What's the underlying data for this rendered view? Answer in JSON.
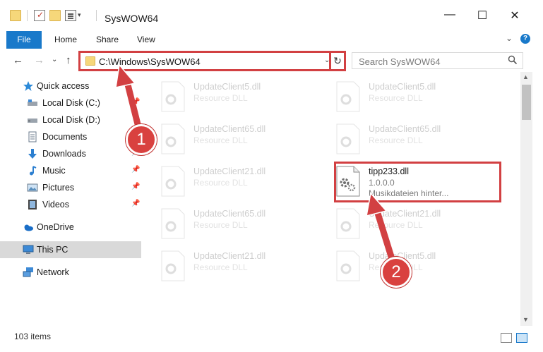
{
  "window": {
    "title": "SysWOW64",
    "minimize": "—",
    "maximize": "☐",
    "close": "✕"
  },
  "ribbon": {
    "tabs": [
      "File",
      "Home",
      "Share",
      "View"
    ],
    "collapse": "⌄",
    "help": "?"
  },
  "nav": {
    "back": "←",
    "forward": "→",
    "recent": "⌄",
    "up": "↑",
    "address": "C:\\Windows\\SysWOW64",
    "address_dropdown": "⌄",
    "refresh": "↻",
    "search_placeholder": "Search SysWOW64"
  },
  "sidebar": {
    "items": [
      {
        "label": "Quick access",
        "icon": "star-icon"
      },
      {
        "label": "Local Disk (C:)",
        "icon": "drive-icon"
      },
      {
        "label": "Local Disk (D:)",
        "icon": "drive-icon"
      },
      {
        "label": "Documents",
        "icon": "documents-icon"
      },
      {
        "label": "Downloads",
        "icon": "download-icon"
      },
      {
        "label": "Music",
        "icon": "music-icon"
      },
      {
        "label": "Pictures",
        "icon": "pictures-icon"
      },
      {
        "label": "Videos",
        "icon": "videos-icon"
      },
      {
        "label": "OneDrive",
        "icon": "cloud-icon"
      },
      {
        "label": "This PC",
        "icon": "pc-icon"
      },
      {
        "label": "Network",
        "icon": "network-icon"
      }
    ],
    "selected": "This PC"
  },
  "files": [
    {
      "name": "UpdateClient5.dll",
      "desc": "Resource DLL"
    },
    {
      "name": "UpdateClient5.dll",
      "desc": "Resource DLL"
    },
    {
      "name": "UpdateClient65.dll",
      "desc": "Resource DLL"
    },
    {
      "name": "UpdateClient65.dll",
      "desc": "Resource DLL"
    },
    {
      "name": "UpdateClient21.dll",
      "desc": "Resource DLL"
    },
    {
      "name": "tipp233.dll",
      "version": "1.0.0.0",
      "desc": "Musikdateien hinter..."
    },
    {
      "name": "UpdateClient65.dll",
      "desc": "Resource DLL"
    },
    {
      "name": "UpdateClient21.dll",
      "desc": "Resource DLL"
    },
    {
      "name": "UpdateClient21.dll",
      "desc": "Resource DLL"
    },
    {
      "name": "UpdateClient5.dll",
      "desc": "Resource DLL"
    }
  ],
  "status": {
    "count": "103 items"
  },
  "annotations": {
    "step1": "1",
    "step2": "2",
    "color": "#d24042"
  },
  "colors": {
    "accent": "#1979ca",
    "highlight": "#d24042"
  }
}
